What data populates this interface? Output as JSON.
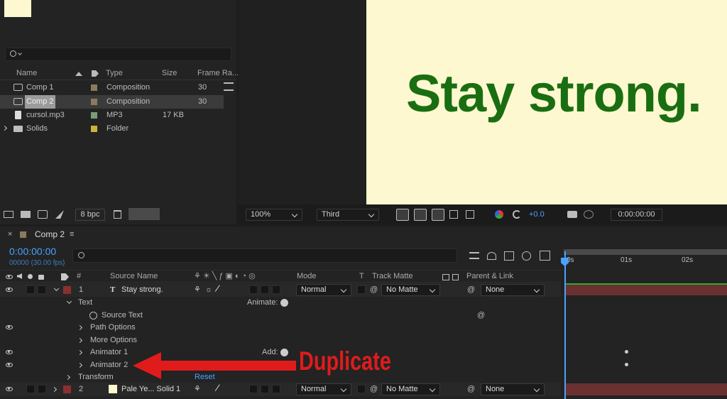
{
  "project": {
    "search_placeholder": "",
    "columns": {
      "name": "Name",
      "type": "Type",
      "size": "Size",
      "frame_rate": "Frame Ra..."
    },
    "items": [
      {
        "name": "Comp 1",
        "type": "Composition",
        "size": "",
        "frame_rate": "30",
        "label_color": "#8b7a5e",
        "icon": "composition-icon"
      },
      {
        "name": "Comp 2",
        "type": "Composition",
        "size": "",
        "frame_rate": "30",
        "label_color": "#8b7a5e",
        "icon": "composition-icon"
      },
      {
        "name": "cursol.mp3",
        "type": "MP3",
        "size": "17 KB",
        "frame_rate": "",
        "label_color": "#7c9a78",
        "icon": "audio-file-icon"
      },
      {
        "name": "Solids",
        "type": "Folder",
        "size": "",
        "frame_rate": "",
        "label_color": "#c8b53a",
        "icon": "folder-icon"
      }
    ],
    "bpc": "8 bpc"
  },
  "viewer": {
    "text": "Stay strong.",
    "text_color": "#1a6e12",
    "bg_color": "#fdf8cf",
    "zoom": "100%",
    "resolution": "Third",
    "exposure": "+0.0",
    "timecode": "0:00:00:00"
  },
  "timeline": {
    "comp_tab": "Comp 2",
    "timecode": "0:00:00:00",
    "fps_info": "00000 (30.00 fps)",
    "columns": {
      "hash": "#",
      "source_name": "Source Name",
      "mode": "Mode",
      "t": "T",
      "track_matte": "Track Matte",
      "parent": "Parent & Link"
    },
    "layer1": {
      "index": "1",
      "name": "Stay strong.",
      "mode": "Normal",
      "matte": "No Matte",
      "parent": "None"
    },
    "text_group": "Text",
    "animate_label": "Animate:",
    "source_text": "Source Text",
    "path_options": "Path Options",
    "more_options": "More Options",
    "animator1": "Animator 1",
    "add_label": "Add:",
    "animator2": "Animator 2",
    "transform": "Transform",
    "reset": "Reset",
    "layer2": {
      "index": "2",
      "name": "Pale Ye... Solid 1",
      "mode": "Normal",
      "matte": "No Matte",
      "parent": "None"
    },
    "ruler": [
      "0s",
      "01s",
      "02s"
    ]
  },
  "annotation": {
    "label": "Duplicate",
    "color": "#e01b1b"
  }
}
